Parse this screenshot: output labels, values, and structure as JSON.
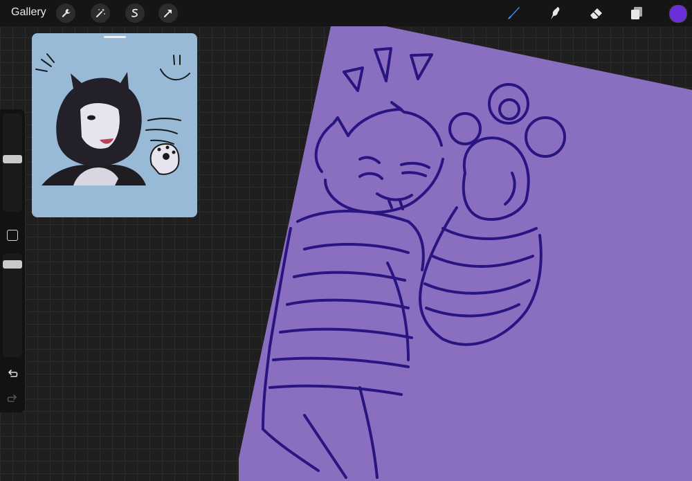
{
  "app": {
    "gallery_label": "Gallery"
  },
  "toolbar": {
    "left_tools": [
      "wrench-icon",
      "magic-wand-icon",
      "selection-icon",
      "transform-arrow-icon"
    ],
    "right_tools": [
      "brush-icon",
      "smudge-icon",
      "eraser-icon",
      "layers-icon"
    ],
    "active_tool": "brush-icon",
    "current_color": "#6a2fd6"
  },
  "sidebar": {
    "brush_size_level": 0.5,
    "opacity_level": 0.95
  },
  "colors": {
    "canvas_fill": "#8a6fc0",
    "line_color": "#2a1480",
    "reference_bg": "#98bad6",
    "accent_blue": "#3a8cff"
  }
}
